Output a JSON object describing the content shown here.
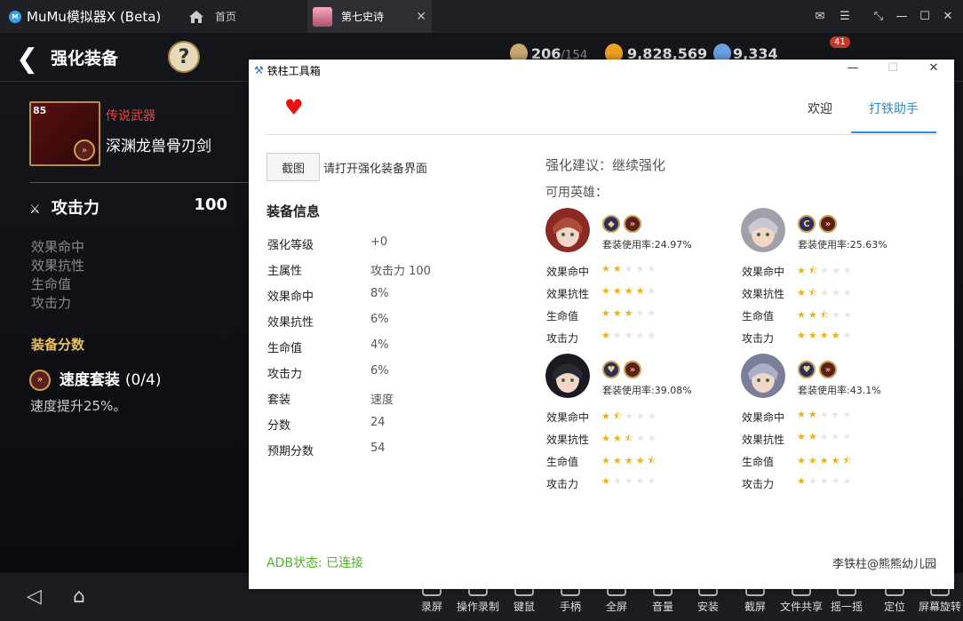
{
  "app": {
    "title": "MuMu模拟器X  (Beta)",
    "home_tab": "首页",
    "game_tab": "第七史诗"
  },
  "game": {
    "title": "强化装备",
    "help": "?",
    "resources": {
      "stamina": "206",
      "stamina_max": "/154",
      "gold": "9,828,569",
      "crystal": "9,334",
      "mail_badge": "41"
    },
    "weapon": {
      "level": "85",
      "rarity": "传说武器",
      "name": "深渊龙兽骨刃剑"
    },
    "main_stat": {
      "label": "攻击力",
      "value": "100"
    },
    "sub_stats": [
      "效果命中",
      "效果抗性",
      "生命值",
      "攻击力"
    ],
    "gear_score_label": "装备分数",
    "set": {
      "name": "速度套装",
      "count": "(0/4)",
      "desc": "速度提升25%。"
    }
  },
  "bottom_bar": {
    "nav": [
      "◁",
      "⌂"
    ],
    "tools": [
      "录屏",
      "操作录制",
      "键鼠",
      "手柄",
      "全屏",
      "音量",
      "安装",
      "截屏",
      "文件共享",
      "摇一摇",
      "定位",
      "屏幕旋转"
    ]
  },
  "dialog": {
    "title": "铁柱工具箱",
    "tabs": [
      "欢迎",
      "打铁助手"
    ],
    "active_tab": "打铁助手",
    "screenshot_button": "截图",
    "hint": "请打开强化装备界面",
    "equip_info_title": "装备信息",
    "equip_info": [
      {
        "k": "强化等级",
        "v": "+0"
      },
      {
        "k": "主属性",
        "v": "攻击力 100"
      },
      {
        "k": "效果命中",
        "v": "8%"
      },
      {
        "k": "效果抗性",
        "v": "6%"
      },
      {
        "k": "生命值",
        "v": "4%"
      },
      {
        "k": "攻击力",
        "v": "6%"
      },
      {
        "k": "套装",
        "v": "速度"
      },
      {
        "k": "分数",
        "v": "24"
      },
      {
        "k": "预期分数",
        "v": "54"
      }
    ],
    "suggestion": "强化建议：继续强化",
    "heroes_label": "可用英雄：",
    "stat_names": [
      "效果命中",
      "效果抗性",
      "生命值",
      "攻击力"
    ],
    "heroes": [
      {
        "usage": "套装使用率:24.97%",
        "stars": [
          2,
          4,
          3,
          1
        ],
        "skin": "#b04a38",
        "hair": "#8a2a22"
      },
      {
        "usage": "套装使用率:25.63%",
        "stars": [
          1.5,
          1.5,
          2.5,
          4
        ],
        "skin": "#c8c8d0",
        "hair": "#a0a0aa"
      },
      {
        "usage": "套装使用率:39.08%",
        "stars": [
          1.5,
          2.5,
          4.5,
          1
        ],
        "skin": "#2a2a32",
        "hair": "#1a1a20"
      },
      {
        "usage": "套装使用率:43.1%",
        "stars": [
          2,
          2,
          4.5,
          1
        ],
        "skin": "#aab0c8",
        "hair": "#7a7e98"
      }
    ],
    "adb_status": "ADB状态: 已连接",
    "author": "李铁柱@熊熊幼儿园"
  }
}
